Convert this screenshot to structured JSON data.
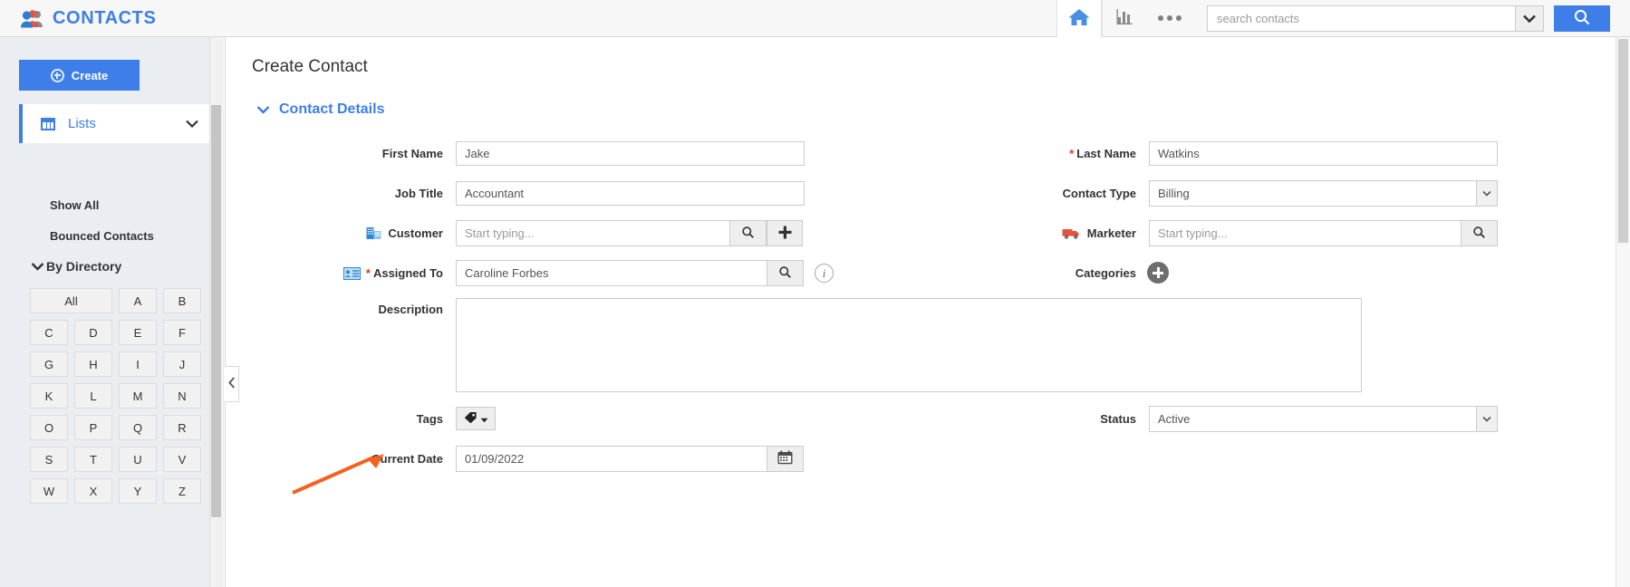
{
  "app": {
    "brand": "CONTACTS",
    "brand_icon": "people-icon",
    "brand_color": "#3d7ee8"
  },
  "topbar": {
    "home_icon": "home-icon",
    "reports_icon": "bar-chart-icon",
    "more_icon": "more-ellipsis-icon",
    "search_placeholder": "search contacts",
    "search_value": "",
    "search_caret_icon": "chevron-down-icon",
    "search_button_icon": "search-icon"
  },
  "sidebar": {
    "create_label": "Create",
    "create_icon": "plus-circle-icon",
    "lists_label": "Lists",
    "lists_icon": "grid-icon",
    "lists_caret_icon": "chevron-down-icon",
    "links": [
      {
        "label": "Show All"
      },
      {
        "label": "Bounced Contacts"
      }
    ],
    "by_directory": {
      "label": "By Directory",
      "caret_icon": "chevron-down-icon"
    },
    "letters": [
      "All",
      "A",
      "B",
      "C",
      "D",
      "E",
      "F",
      "G",
      "H",
      "I",
      "J",
      "K",
      "L",
      "M",
      "N",
      "O",
      "P",
      "Q",
      "R",
      "S",
      "T",
      "U",
      "V",
      "W",
      "X",
      "Y",
      "Z"
    ],
    "collapse_icon": "chevron-left-icon"
  },
  "main": {
    "page_title": "Create Contact",
    "section": {
      "title": "Contact Details",
      "caret_icon": "chevron-down-icon"
    },
    "fields": {
      "first_name": {
        "label": "First Name",
        "value": "Jake",
        "required": false
      },
      "last_name": {
        "label": "Last Name",
        "value": "Watkins",
        "required": true
      },
      "job_title": {
        "label": "Job Title",
        "value": "Accountant",
        "required": false
      },
      "contact_type": {
        "label": "Contact Type",
        "value": "Billing",
        "required": false,
        "caret_icon": "chevron-down-icon"
      },
      "customer": {
        "label": "Customer",
        "value": "",
        "placeholder": "Start typing...",
        "icon": "building-icon",
        "search_icon": "search-icon",
        "add_icon": "plus-icon"
      },
      "marketer": {
        "label": "Marketer",
        "value": "",
        "placeholder": "Start typing...",
        "icon": "truck-icon",
        "search_icon": "search-icon"
      },
      "assigned_to": {
        "label": "Assigned To",
        "value": "Caroline Forbes",
        "required": true,
        "icon": "contact-card-icon",
        "search_icon": "search-icon",
        "info_icon": "info-icon"
      },
      "categories": {
        "label": "Categories",
        "add_icon": "plus-circle-filled-icon"
      },
      "description": {
        "label": "Description",
        "value": ""
      },
      "tags": {
        "label": "Tags",
        "icon": "tag-icon",
        "caret_icon": "caret-down-icon"
      },
      "status": {
        "label": "Status",
        "value": "Active",
        "caret_icon": "chevron-down-icon"
      },
      "current_date": {
        "label": "Current Date",
        "value": "01/09/2022",
        "calendar_icon": "calendar-icon"
      }
    },
    "annotation": {
      "arrow_color": "#f4621f",
      "arrow_icon": "pointer-arrow"
    }
  }
}
